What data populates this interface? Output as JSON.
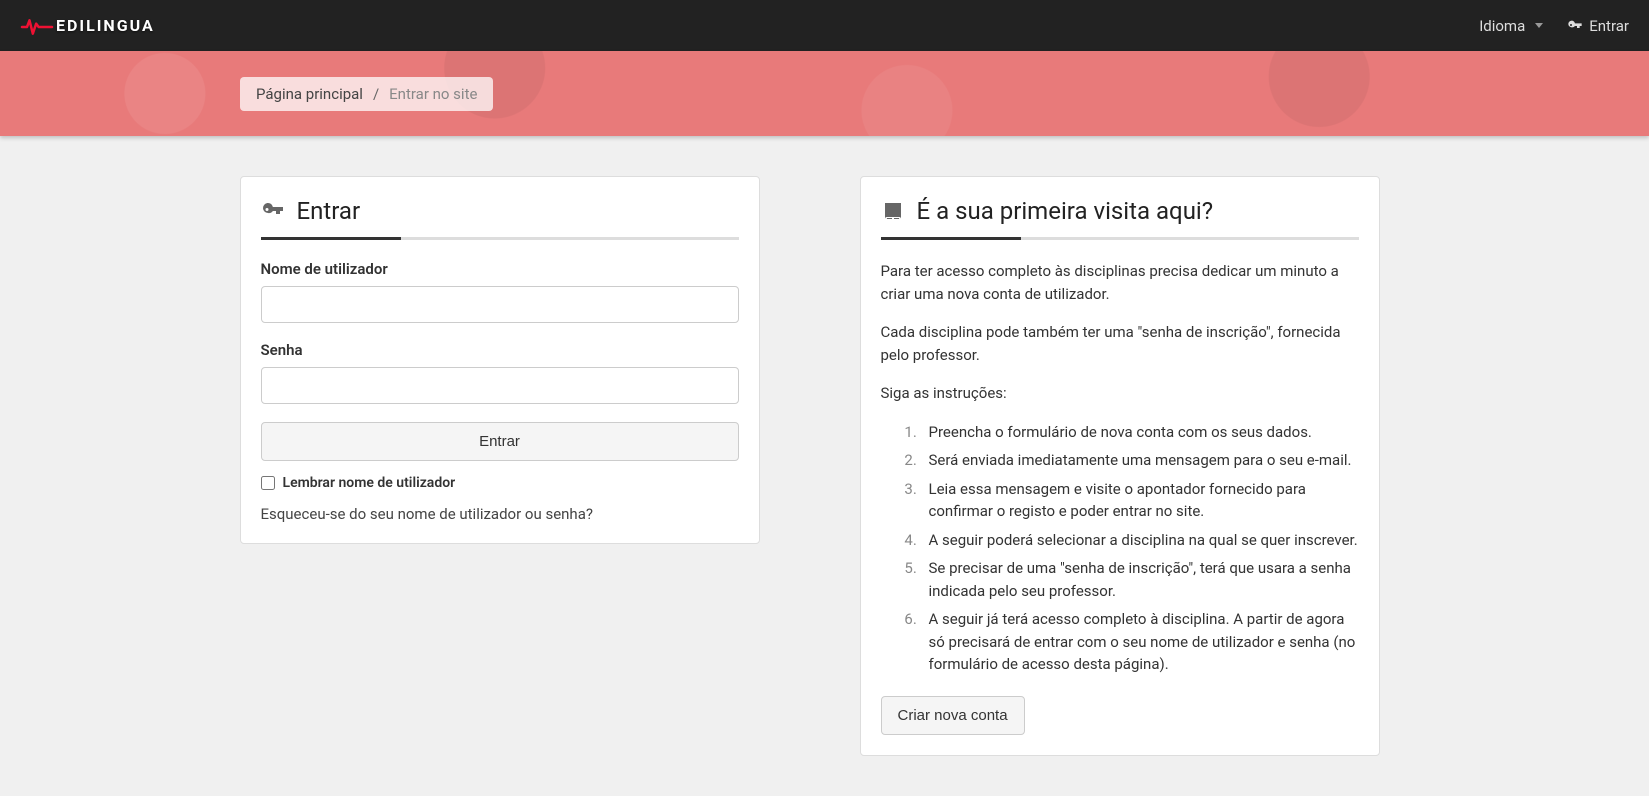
{
  "topnav": {
    "logo_text": "EDILINGUA",
    "language_label": "Idioma",
    "login_label": "Entrar"
  },
  "breadcrumb": {
    "home": "Página principal",
    "current": "Entrar no site"
  },
  "login_card": {
    "heading": "Entrar",
    "username_label": "Nome de utilizador",
    "password_label": "Senha",
    "submit_label": "Entrar",
    "remember_label": "Lembrar nome de utilizador",
    "forgot_label": "Esqueceu-se do seu nome de utilizador ou senha?"
  },
  "signup_card": {
    "heading": "É a sua primeira visita aqui?",
    "intro1": "Para ter acesso completo às disciplinas precisa dedicar um minuto a criar uma nova conta de utilizador.",
    "intro2": "Cada disciplina pode também ter uma \"senha de inscrição\", fornecida pelo professor.",
    "intro3": "Siga as instruções:",
    "steps": [
      "Preencha o formulário de nova conta com os seus dados.",
      "Será enviada imediatamente uma mensagem para o seu e-mail.",
      "Leia essa mensagem e visite o apontador fornecido para confirmar o registo e poder entrar no site.",
      "A seguir poderá selecionar a disciplina na qual se quer inscrever.",
      "Se precisar de uma \"senha de inscrição\", terá que usara a senha indicada pelo seu professor.",
      "A seguir já terá acesso completo à disciplina. A partir de agora só precisará de entrar com o seu nome de utilizador e senha (no formulário de acesso desta página)."
    ],
    "create_button": "Criar nova conta"
  }
}
